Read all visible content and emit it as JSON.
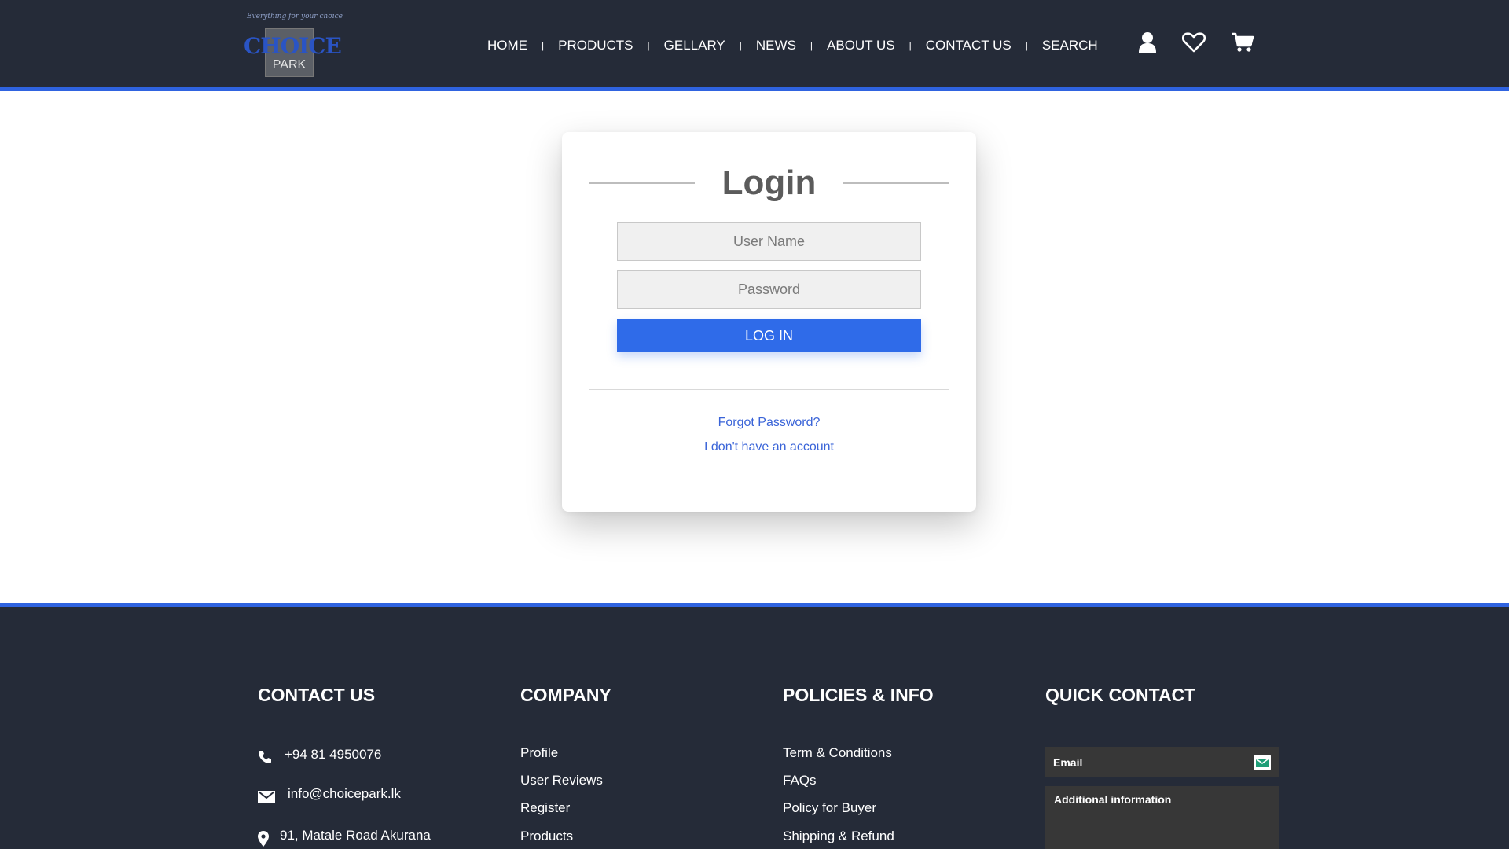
{
  "header": {
    "logo": {
      "tagline": "Everything for your choice",
      "name": "CHOICE",
      "sub": "PARK"
    },
    "nav": [
      "HOME",
      "PRODUCTS",
      "GELLARY",
      "NEWS",
      "ABOUT US",
      "CONTACT US",
      "SEARCH"
    ],
    "icons": [
      "user-icon",
      "heart-icon",
      "cart-icon"
    ]
  },
  "login": {
    "title": "Login",
    "username_placeholder": "User Name",
    "password_placeholder": "Password",
    "button": "LOG IN",
    "forgot": "Forgot Password?",
    "no_account": "I don't have an account"
  },
  "footer": {
    "contact": {
      "title": "CONTACT US",
      "phone": "+94 81 4950076",
      "email": "info@choicepark.lk",
      "address": "91, Matale Road Akurana"
    },
    "company": {
      "title": "COMPANY",
      "links": [
        "Profile",
        "User Reviews",
        "Register",
        "Products"
      ]
    },
    "policies": {
      "title": "POLICIES & INFO",
      "links": [
        "Term & Conditions",
        "FAQs",
        "Policy for Buyer",
        "Shipping & Refund"
      ]
    },
    "quick": {
      "title": "QUICK CONTACT",
      "email_label": "Email",
      "additional_label": "Additional information"
    }
  },
  "colors": {
    "dark": "#252b38",
    "accent": "#2f63e0",
    "button": "#2f6be9",
    "link": "#3a64d8"
  }
}
